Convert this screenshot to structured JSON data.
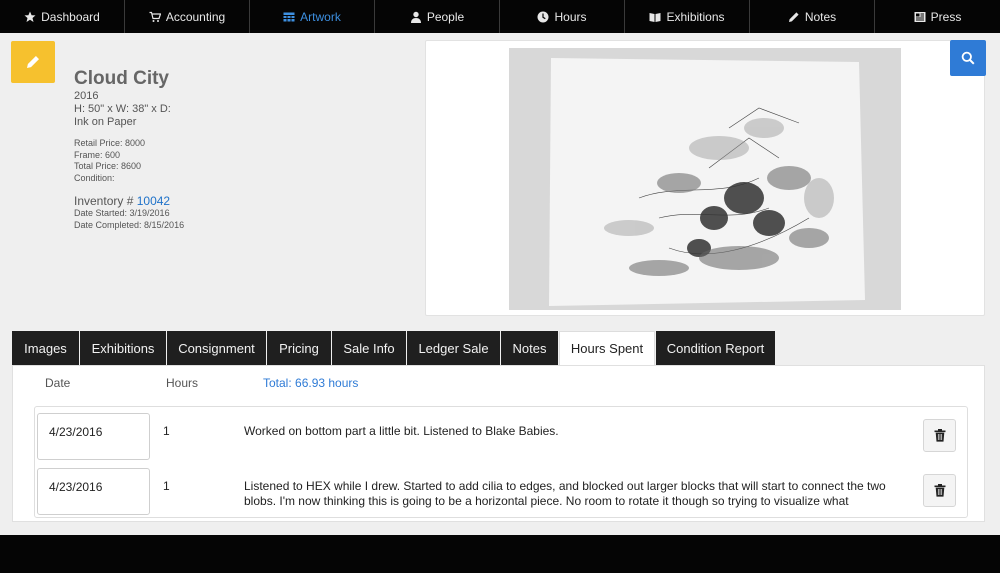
{
  "nav": [
    {
      "label": "Dashboard",
      "icon": "star-icon"
    },
    {
      "label": "Accounting",
      "icon": "cart-icon"
    },
    {
      "label": "Artwork",
      "icon": "table-icon"
    },
    {
      "label": "People",
      "icon": "person-icon"
    },
    {
      "label": "Hours",
      "icon": "clock-icon"
    },
    {
      "label": "Exhibitions",
      "icon": "book-icon"
    },
    {
      "label": "Notes",
      "icon": "pencil-icon"
    },
    {
      "label": "Press",
      "icon": "newspaper-icon"
    }
  ],
  "nav_active": "Artwork",
  "artwork": {
    "title": "Cloud City",
    "year": "2016",
    "dimensions": "H: 50\" x W: 38\" x D:",
    "medium": "Ink on Paper",
    "retail_price": "Retail Price: 8000",
    "frame": "Frame: 600",
    "total_price": "Total Price: 8600",
    "condition": "Condition:",
    "inventory_label": "Inventory #",
    "inventory_number": "10042",
    "date_started": "Date Started: 3/19/2016",
    "date_completed": "Date Completed: 8/15/2016"
  },
  "tabs": [
    "Images",
    "Exhibitions",
    "Consignment",
    "Pricing",
    "Sale Info",
    "Ledger Sale",
    "Notes",
    "Hours Spent",
    "Condition Report"
  ],
  "active_tab": "Hours Spent",
  "hours": {
    "col_date": "Date",
    "col_hours": "Hours",
    "total": "Total: 66.93 hours",
    "rows": [
      {
        "date": "4/23/2016",
        "hours": "1",
        "note": "Worked on bottom part a little bit.  Listened to Blake Babies."
      },
      {
        "date": "4/23/2016",
        "hours": "1",
        "note": "Listened to HEX while I drew.  Started to add cilia to edges, and blocked out larger blocks that will start to connect the two blobs.  I'm now thinking this is going to be a horizontal piece.  No room to rotate it though so trying to visualize what"
      }
    ]
  },
  "colors": {
    "accent_blue": "#2f7bd6",
    "edit_yellow": "#f6c12e",
    "nav_bg": "#050505"
  }
}
